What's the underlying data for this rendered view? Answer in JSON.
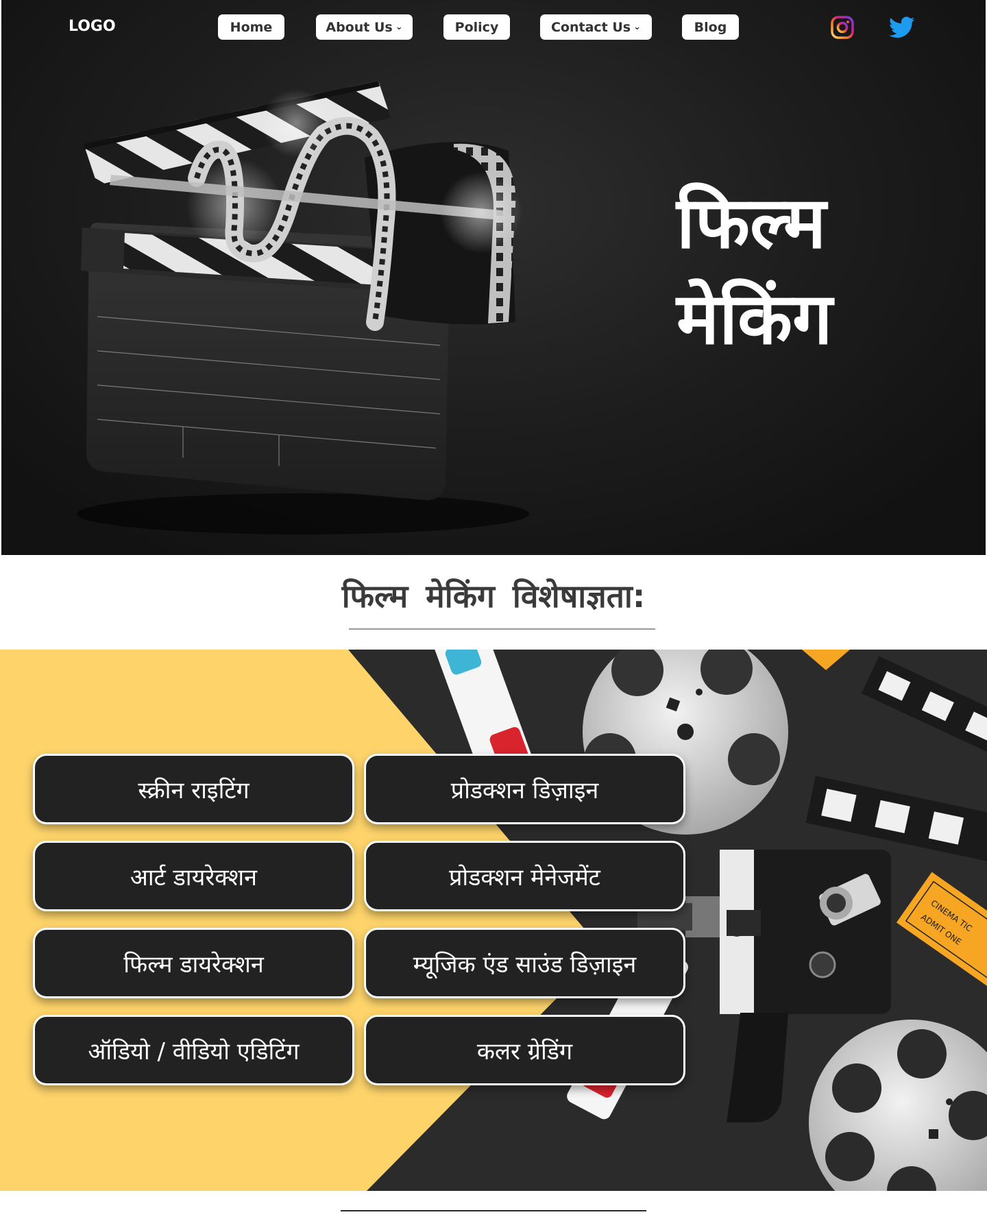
{
  "nav": {
    "logo": "LOGO",
    "items": [
      {
        "label": "Home",
        "dropdown": false
      },
      {
        "label": "About Us",
        "dropdown": true
      },
      {
        "label": "Policy",
        "dropdown": false
      },
      {
        "label": "Contact Us",
        "dropdown": true
      },
      {
        "label": "Blog",
        "dropdown": false
      }
    ],
    "social": [
      "instagram-icon",
      "twitter-icon"
    ],
    "chevron": "⌄"
  },
  "hero": {
    "title_line1": "फिल्म",
    "title_line2": "मेकिंग"
  },
  "specialties": {
    "heading": "फिल्म मेकिंग विशेषाज्ञता:",
    "items": [
      "स्क्रीन राइटिंग",
      "प्रोडक्शन डिज़ाइन",
      "आर्ट डायरेक्शन",
      "प्रोडक्शन मेनेजमेंट",
      "फिल्म डायरेक्शन",
      "म्यूजिक एंड  साउंड डिज़ाइन",
      "ऑडियो / वीडियो एडिटिंग",
      "कलर ग्रेडिंग"
    ],
    "ticket_text": [
      "CINEMA TIC",
      "ADMIT ONE"
    ]
  },
  "colors": {
    "hero_bg": "#1d1d1d",
    "pill_bg": "#222222",
    "band_yellow": "#fdd36a",
    "band_dark": "#2b2b2b",
    "twitter_blue": "#1d9bf0",
    "ticket_orange": "#f6a623"
  }
}
